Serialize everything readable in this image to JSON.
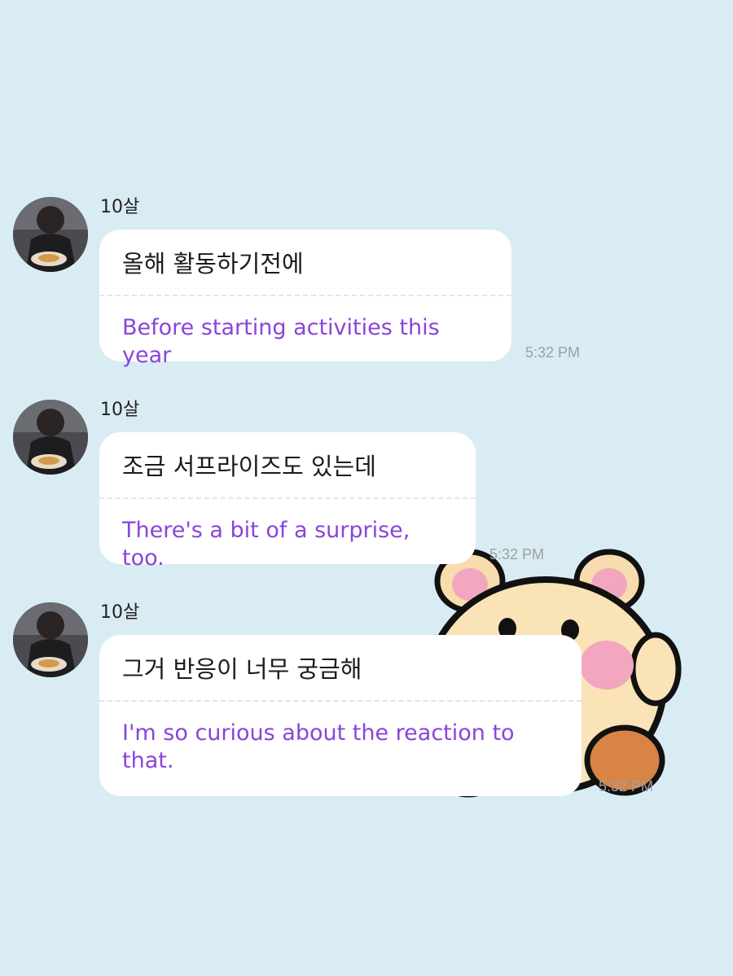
{
  "messages": [
    {
      "sender": "10살",
      "original": "올해 활동하기전에",
      "translation": "Before starting activities this year",
      "time": "5:32 PM"
    },
    {
      "sender": "10살",
      "original": "조금 서프라이즈도 있는데",
      "translation": "There's a bit of a surprise, too.",
      "time": "5:32 PM"
    },
    {
      "sender": "10살",
      "original": "그거 반응이 너무 궁금해",
      "translation": "I'm so curious about the reaction to that.",
      "time": "5:32 PM"
    }
  ],
  "sticker": {
    "icon": "hamster-sticker-icon"
  },
  "colors": {
    "background": "#d9ecf3",
    "bubble": "#ffffff",
    "translation_text": "#8a44dc",
    "timestamp": "#a0a0a0"
  }
}
